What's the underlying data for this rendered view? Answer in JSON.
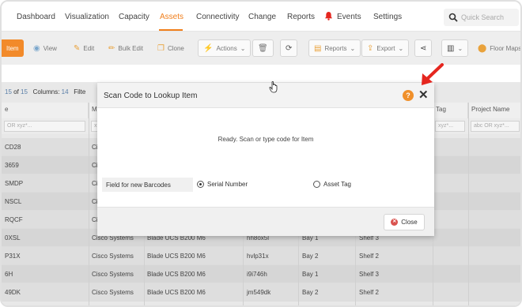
{
  "nav": {
    "items": [
      "Dashboard",
      "Visualization",
      "Capacity",
      "Assets",
      "Connectivity",
      "Change",
      "Reports",
      "Events",
      "Settings"
    ],
    "active": "Assets",
    "search_placeholder": "Quick Search"
  },
  "toolbar": {
    "item": "Item",
    "view": "View",
    "edit": "Edit",
    "bulk_edit": "Bulk Edit",
    "clone": "Clone",
    "actions": "Actions",
    "reports": "Reports",
    "export": "Export",
    "floor_maps": "Floor Maps"
  },
  "grid": {
    "count_prefix": "15",
    "count_of": "of",
    "count_total": "15",
    "columns_label": "Columns:",
    "columns_value": "14",
    "filter_label": "Filte",
    "headers": [
      "e",
      "M",
      "Tag",
      "Project Name"
    ],
    "filter_placeholders": [
      "OR xyz*...",
      "x",
      "xyz*...",
      "abc OR xyz*..."
    ],
    "rows": [
      [
        "CD28",
        "Ci",
        "",
        "",
        "",
        "",
        ""
      ],
      [
        "3659",
        "Ci",
        "",
        "",
        "",
        "",
        ""
      ],
      [
        "SMDP",
        "Ci",
        "",
        "",
        "",
        "",
        ""
      ],
      [
        "NSCL",
        "Ci",
        "",
        "",
        "",
        "",
        ""
      ],
      [
        "RQCF",
        "Ci",
        "",
        "",
        "",
        "",
        ""
      ],
      [
        "0XSL",
        "Cisco Systems",
        "Blade UCS B200 M6",
        "hh8ox5l",
        "Bay 1",
        "Shelf 3",
        ""
      ],
      [
        "P31X",
        "Cisco Systems",
        "Blade UCS B200 M6",
        "hvlp31x",
        "Bay 2",
        "Shelf 2",
        ""
      ],
      [
        "6H",
        "Cisco Systems",
        "Blade UCS B200 M6",
        "i9i746h",
        "Bay 1",
        "Shelf 3",
        ""
      ],
      [
        "49DK",
        "Cisco Systems",
        "Blade UCS B200 M6",
        "jm549dk",
        "Bay 2",
        "Shelf 2",
        ""
      ]
    ]
  },
  "modal": {
    "title": "Scan Code to Lookup Item",
    "help": "?",
    "close_x": "✕",
    "status": "Ready. Scan or type code for Item",
    "field_label": "Field for new Barcodes",
    "option_serial": "Serial Number",
    "option_asset": "Asset Tag",
    "selected": "Serial Number",
    "close_button": "Close"
  },
  "colors": {
    "accent": "#f07e1b",
    "help": "#f0902b",
    "close_button_icon": "#d9534f",
    "annotation_arrow": "#e5261f"
  }
}
